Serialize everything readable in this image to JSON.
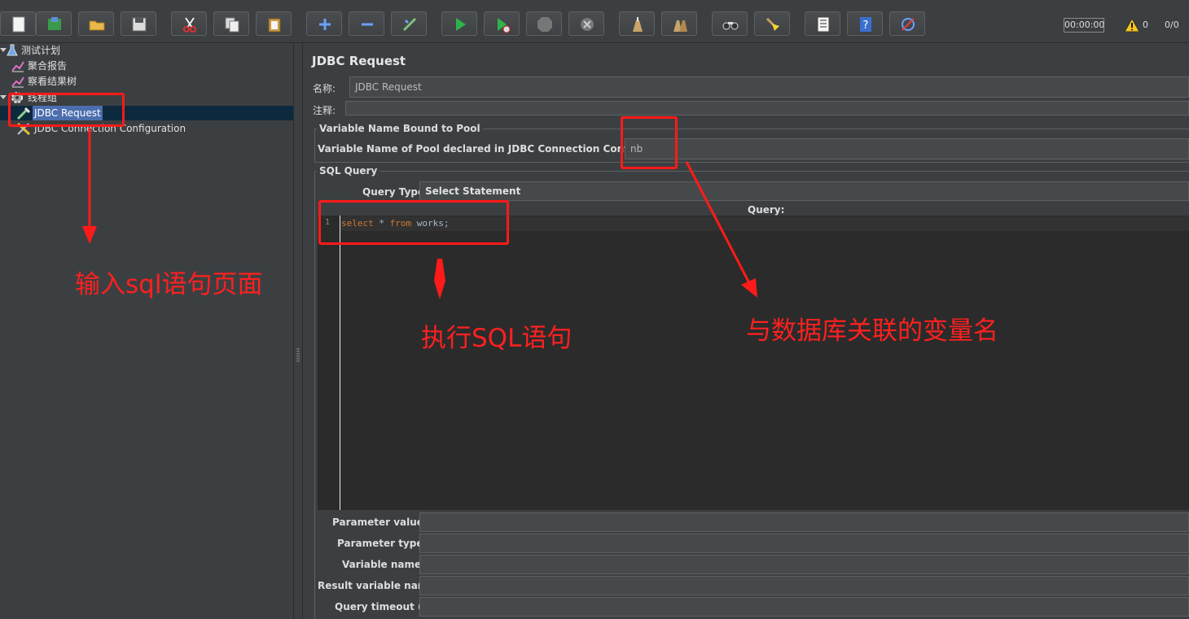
{
  "toolbar": {
    "timer": "00:00:00",
    "warning_count": "0",
    "threads": "0/0",
    "icons": [
      "new-icon",
      "templates-icon",
      "open-icon",
      "save-icon",
      "cut-icon",
      "copy-icon",
      "paste-icon",
      "expand-icon",
      "collapse-icon",
      "toggle-icon",
      "start-icon",
      "start-no-pause-icon",
      "stop-icon",
      "shutdown-icon",
      "clear-icon",
      "clear-all-icon",
      "search-icon",
      "reset-search-icon",
      "function-helper-icon",
      "help-icon",
      "remote-icon"
    ]
  },
  "tree": {
    "test_plan": "测试计划",
    "aggregate_report": "聚合报告",
    "view_results_tree": "察看结果树",
    "thread_group": "线程组",
    "jdbc_request": "JDBC Request",
    "jdbc_connection_config": "JDBC Connection Configuration"
  },
  "panel": {
    "title": "JDBC Request",
    "name_label": "名称:",
    "name_value": "JDBC Request",
    "comment_label": "注释:",
    "comment_value": "",
    "pool_section": "Variable Name Bound to Pool",
    "pool_label": "Variable Name of Pool declared in JDBC Connection Configuration",
    "pool_value": "nb",
    "sql_section": "SQL Query",
    "query_type_label": "Query Type:",
    "query_type_value": "Select Statement",
    "query_header": "Query:",
    "line_number": "1",
    "code": {
      "kw1": "select",
      "mid": " * ",
      "kw2": "from",
      "rest": " works;"
    },
    "param_values_label": "Parameter values:",
    "param_types_label": "Parameter types:",
    "variable_names_label": "Variable names:",
    "result_variable_label": "Result variable name:",
    "query_timeout_label": "Query timeout (s):"
  },
  "annotations": {
    "left": "输入sql语句页面",
    "middle": "执行SQL语句",
    "right": "与数据库关联的变量名"
  },
  "colors": {
    "annotation_red": "#ff1a1a",
    "background": "#3c3f41",
    "selection": "#4b6eaf",
    "sql_keyword": "#cc7832"
  }
}
